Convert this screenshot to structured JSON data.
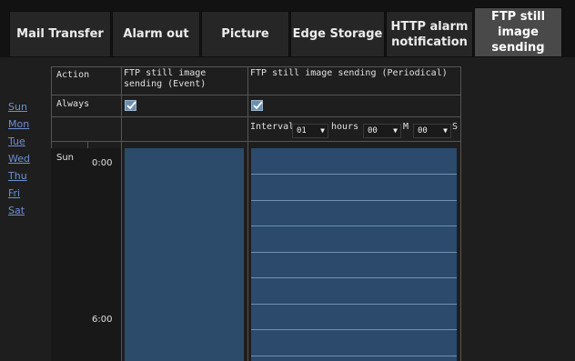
{
  "tabs": [
    {
      "label": "Mail Transfer",
      "active": false
    },
    {
      "label": "Alarm out",
      "active": false
    },
    {
      "label": "Picture",
      "active": false
    },
    {
      "label": "Edge Storage",
      "active": false
    },
    {
      "label": "HTTP alarm notification",
      "active": false
    },
    {
      "label": "FTP still image sending",
      "active": true
    }
  ],
  "days": [
    "Sun",
    "Mon",
    "Tue",
    "Wed",
    "Thu",
    "Fri",
    "Sat"
  ],
  "table": {
    "action_label": "Action",
    "col_event": "FTP still image sending (Event)",
    "col_periodical": "FTP still image sending (Periodical)",
    "always_label": "Always",
    "always_event_checked": true,
    "always_periodical_checked": true,
    "interval_label": "Interval",
    "hours_value": "01",
    "hours_label": "hours",
    "minutes_value": "00",
    "minutes_label": "M",
    "seconds_value": "00",
    "seconds_label": "S",
    "current_day": "Sun",
    "time_0": "0:00",
    "time_6": "6:00"
  },
  "colors": {
    "accent_block": "#2c4a6a",
    "link": "#6f8fd2",
    "active_tab": "#494949"
  }
}
